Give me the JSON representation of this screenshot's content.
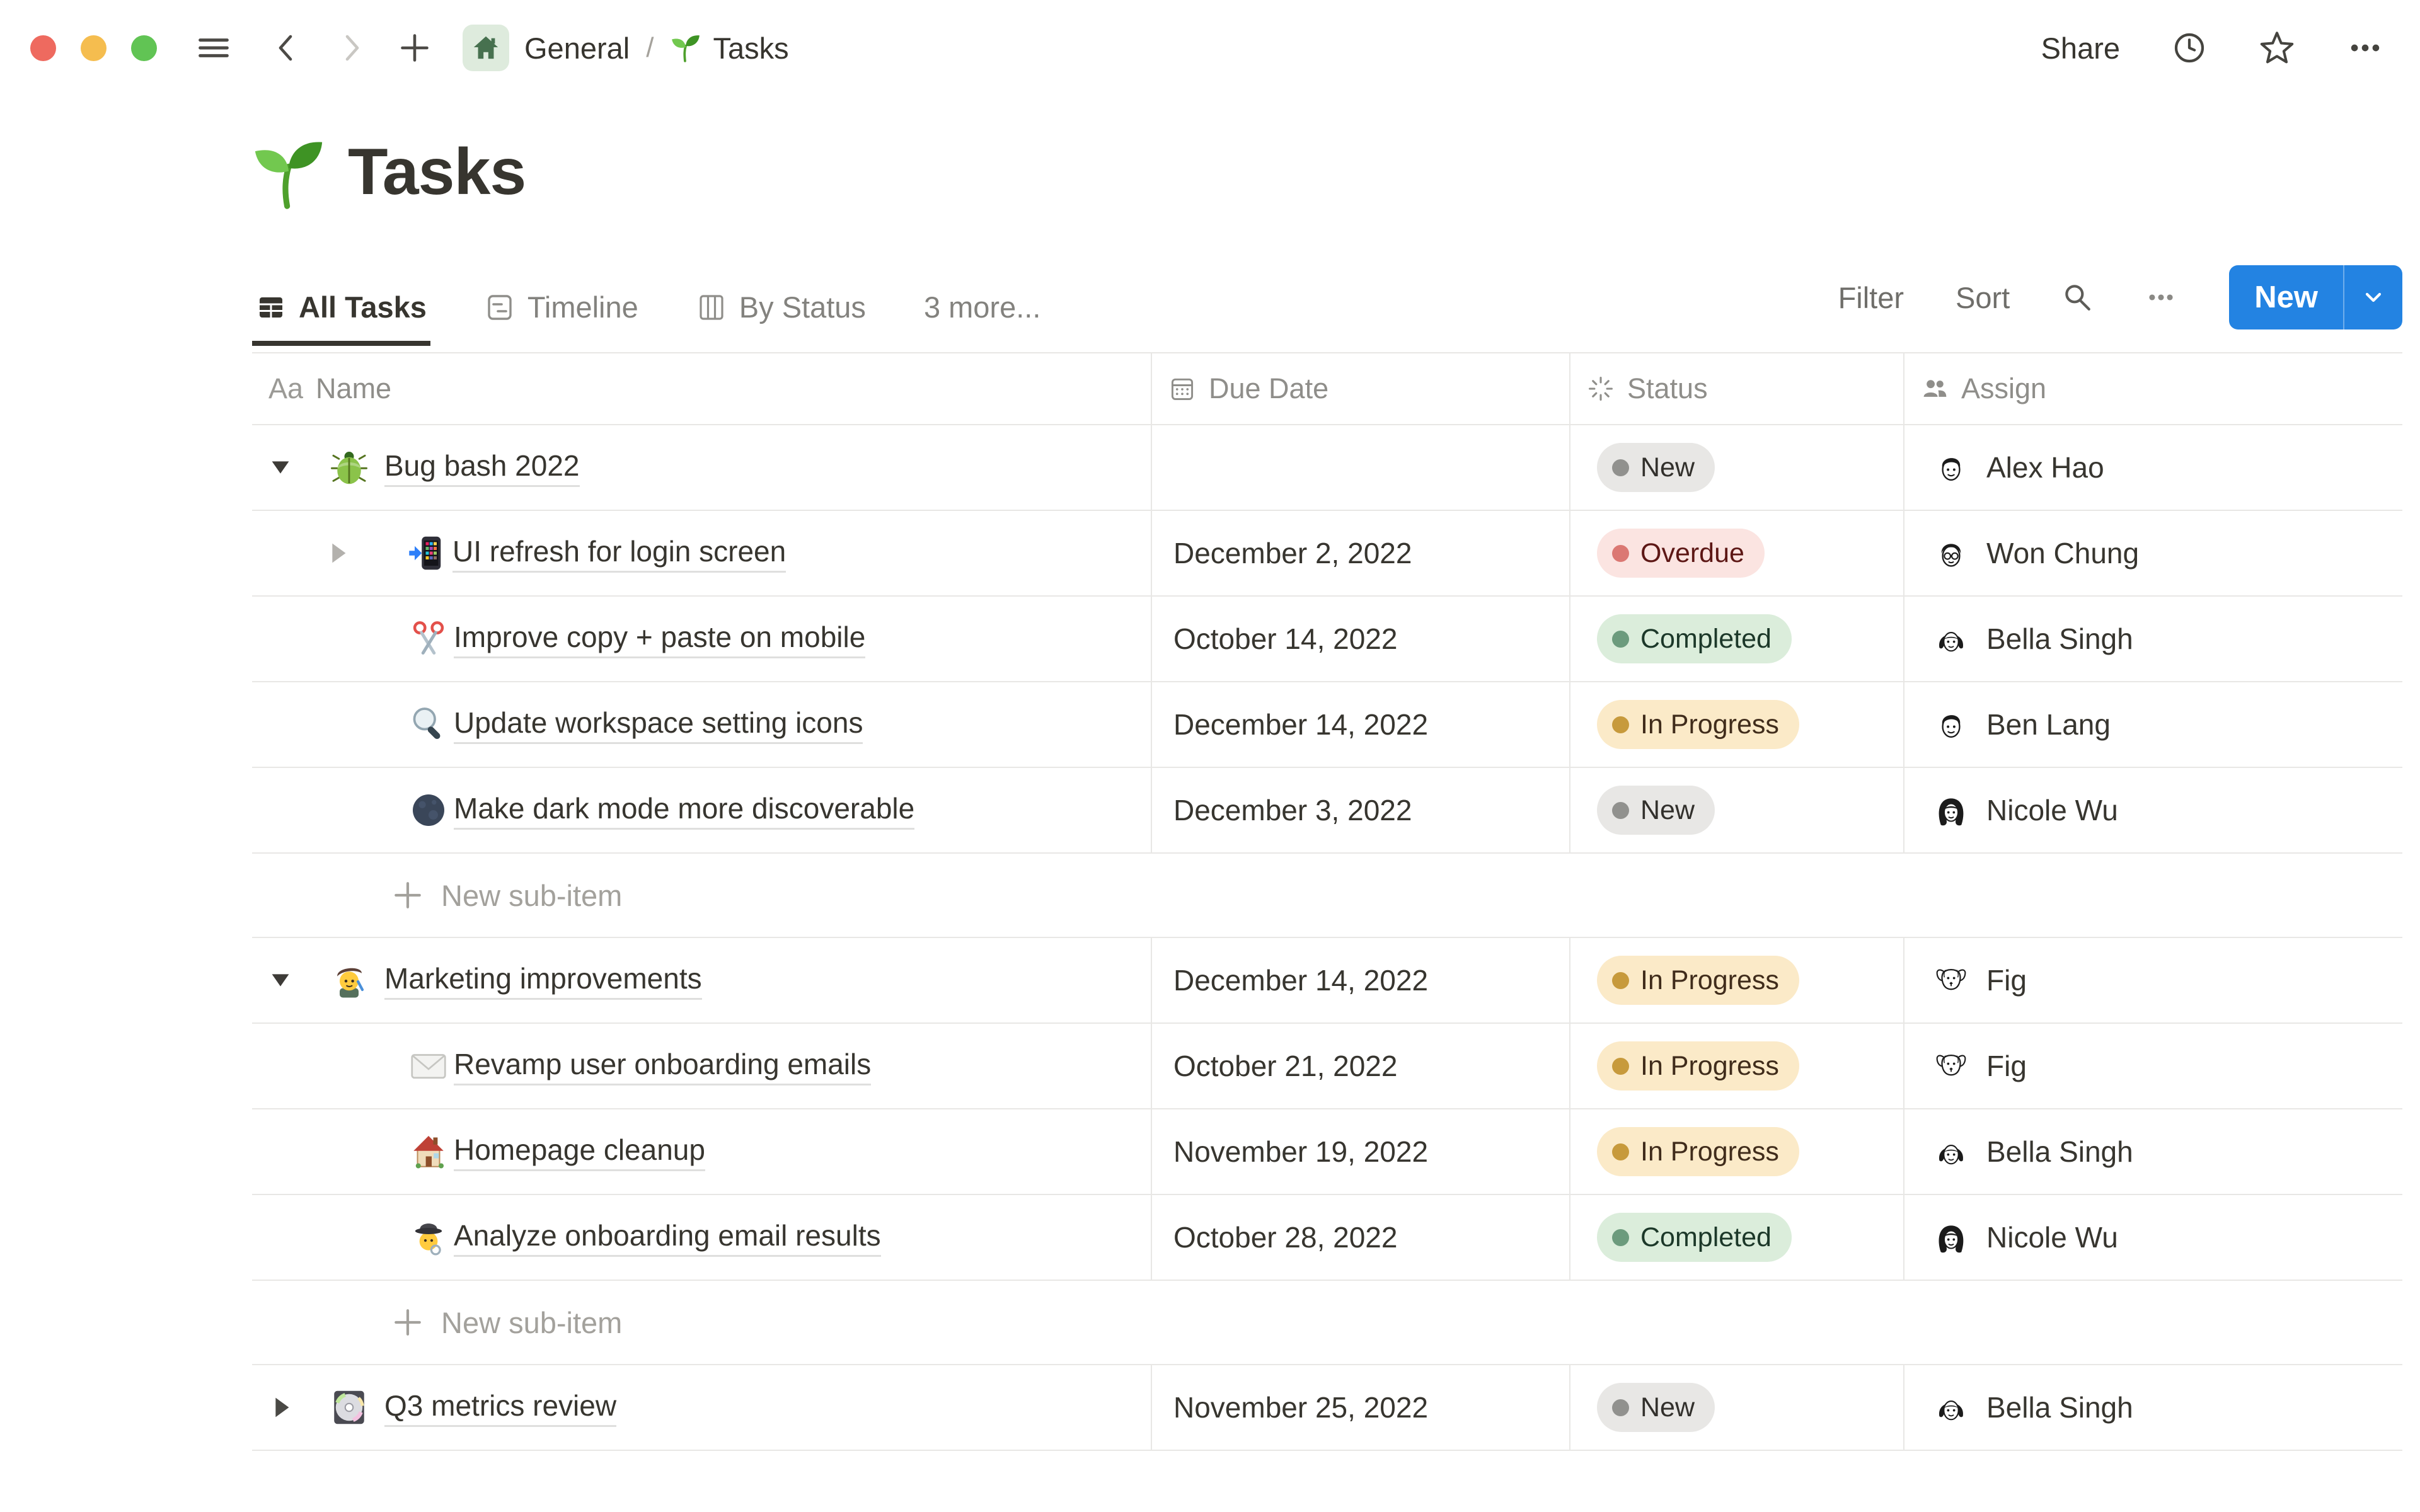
{
  "titlebar": {
    "breadcrumb": {
      "root": "General",
      "separator": "/",
      "page_icon": "seedling",
      "page": "Tasks"
    },
    "share_label": "Share"
  },
  "page": {
    "icon": "seedling",
    "title": "Tasks"
  },
  "views": {
    "tabs": [
      {
        "label": "All Tasks",
        "icon": "table-icon",
        "active": true
      },
      {
        "label": "Timeline",
        "icon": "timeline-icon",
        "active": false
      },
      {
        "label": "By Status",
        "icon": "board-icon",
        "active": false
      },
      {
        "label": "3 more...",
        "icon": null,
        "active": false
      }
    ],
    "actions": {
      "filter": "Filter",
      "sort": "Sort",
      "new_label": "New",
      "new_color": "#2383E2"
    }
  },
  "table": {
    "columns": [
      {
        "key": "name",
        "label": "Name",
        "icon": "aa-icon",
        "aa_glyph": "Aa"
      },
      {
        "key": "due",
        "label": "Due Date",
        "icon": "calendar-icon"
      },
      {
        "key": "status",
        "label": "Status",
        "icon": "status-icon"
      },
      {
        "key": "assign",
        "label": "Assign",
        "icon": "people-icon"
      }
    ],
    "status_styles": {
      "New": {
        "bg": "#E8E7E5",
        "dot": "#91918E",
        "text": "#32302C"
      },
      "Overdue": {
        "bg": "#FBE4E1",
        "dot": "#D browse",
        "text": "#5D1715"
      },
      "Completed": {
        "bg": "#DBEDDB",
        "dot": "#6C9B7D",
        "text": "#1C3829"
      },
      "In Progress": {
        "bg": "#FBEAC8",
        "dot": "#C79A3C",
        "text": "#402C1B"
      }
    },
    "rows": [
      {
        "type": "task",
        "level": 0,
        "toggle": "open",
        "icon": "beetle",
        "name": "Bug bash 2022",
        "due": "",
        "status": "New",
        "assign": {
          "name": "Alex Hao",
          "avatar": "man"
        }
      },
      {
        "type": "task",
        "level": 1,
        "toggle": "closed",
        "icon": "phone",
        "name": "UI refresh for login screen",
        "due": "December 2, 2022",
        "status": "Overdue",
        "assign": {
          "name": "Won Chung",
          "avatar": "man-glasses"
        }
      },
      {
        "type": "task",
        "level": 1,
        "toggle": null,
        "icon": "scissors",
        "name": "Improve copy + paste on mobile",
        "due": "October 14, 2022",
        "status": "Completed",
        "assign": {
          "name": "Bella Singh",
          "avatar": "woman-bob"
        }
      },
      {
        "type": "task",
        "level": 1,
        "toggle": null,
        "icon": "magnifier",
        "name": "Update workspace setting icons",
        "due": "December 14, 2022",
        "status": "In Progress",
        "assign": {
          "name": "Ben Lang",
          "avatar": "man"
        }
      },
      {
        "type": "task",
        "level": 1,
        "toggle": null,
        "icon": "moon",
        "name": "Make dark mode more discoverable",
        "due": "December 3, 2022",
        "status": "New",
        "assign": {
          "name": "Nicole Wu",
          "avatar": "woman-long"
        }
      },
      {
        "type": "new-sub-item",
        "label": "New sub-item"
      },
      {
        "type": "task",
        "level": 0,
        "toggle": "open",
        "icon": "artist",
        "name": "Marketing improvements",
        "due": "December 14, 2022",
        "status": "In Progress",
        "assign": {
          "name": "Fig",
          "avatar": "dog"
        }
      },
      {
        "type": "task",
        "level": 1,
        "toggle": null,
        "icon": "envelope",
        "name": "Revamp user onboarding emails",
        "due": "October 21, 2022",
        "status": "In Progress",
        "assign": {
          "name": "Fig",
          "avatar": "dog"
        }
      },
      {
        "type": "task",
        "level": 1,
        "toggle": null,
        "icon": "house",
        "name": "Homepage cleanup",
        "due": "November 19, 2022",
        "status": "In Progress",
        "assign": {
          "name": "Bella Singh",
          "avatar": "woman-bob"
        }
      },
      {
        "type": "task",
        "level": 1,
        "toggle": null,
        "icon": "detective",
        "name": "Analyze onboarding email results",
        "due": "October 28, 2022",
        "status": "Completed",
        "assign": {
          "name": "Nicole Wu",
          "avatar": "woman-long"
        }
      },
      {
        "type": "new-sub-item",
        "label": "New sub-item"
      },
      {
        "type": "task",
        "level": 0,
        "toggle": "closed-dark",
        "icon": "cd",
        "name": "Q3 metrics review",
        "due": "November 25, 2022",
        "status": "New",
        "assign": {
          "name": "Bella Singh",
          "avatar": "woman-bob"
        }
      }
    ]
  }
}
